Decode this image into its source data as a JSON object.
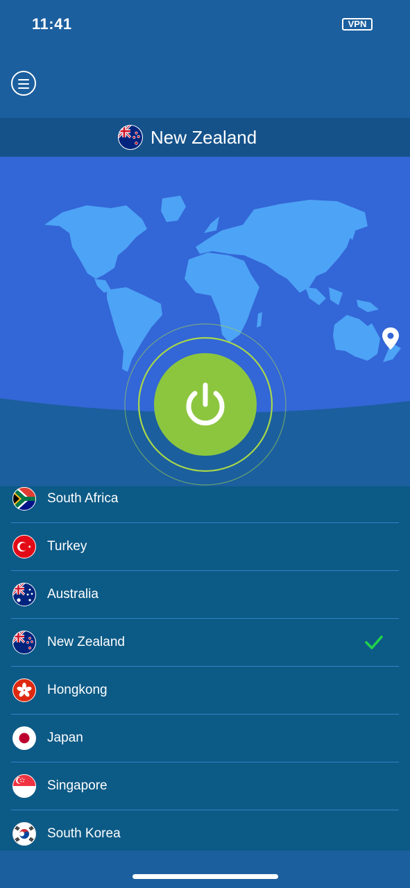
{
  "status_bar": {
    "time": "11:41",
    "vpn_badge": "VPN"
  },
  "header": {
    "menu_icon": "hamburger-menu-icon"
  },
  "current_location": {
    "name": "New Zealand",
    "flag": "new-zealand-flag-icon"
  },
  "map": {
    "pin_icon": "location-pin-icon",
    "continent_color": "#4da3f6",
    "ocean_color": "#3366d6"
  },
  "connect": {
    "button_icon": "power-icon",
    "button_color": "#8cc63f",
    "ring_color": "#a8d84a",
    "state": "connected"
  },
  "countries": [
    {
      "name": "South Africa",
      "flag": "south-africa-flag-icon",
      "selected": false
    },
    {
      "name": "Turkey",
      "flag": "turkey-flag-icon",
      "selected": false
    },
    {
      "name": "Australia",
      "flag": "australia-flag-icon",
      "selected": false
    },
    {
      "name": "New Zealand",
      "flag": "new-zealand-flag-icon",
      "selected": true
    },
    {
      "name": "Hongkong",
      "flag": "hongkong-flag-icon",
      "selected": false
    },
    {
      "name": "Japan",
      "flag": "japan-flag-icon",
      "selected": false
    },
    {
      "name": "Singapore",
      "flag": "singapore-flag-icon",
      "selected": false
    },
    {
      "name": "South Korea",
      "flag": "south-korea-flag-icon",
      "selected": false
    }
  ],
  "selection_indicator": {
    "icon": "checkmark-icon",
    "color": "#22d34a"
  }
}
